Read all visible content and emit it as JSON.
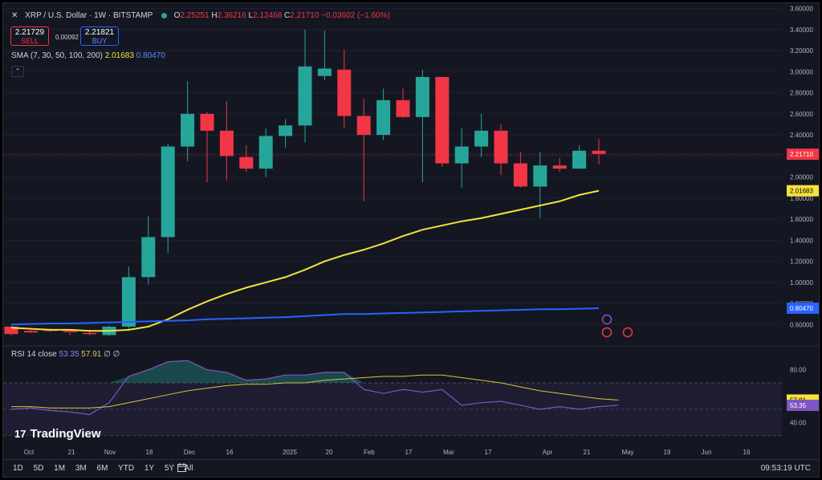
{
  "header": {
    "close_glyph": "✕",
    "symbol": "XRP / U.S. Dollar · 1W · BITSTAMP",
    "o_key": "O",
    "o_val": "2.25251",
    "h_key": "H",
    "h_val": "2.36216",
    "l_key": "L",
    "l_val": "2.12468",
    "c_key": "C",
    "c_val": "2.21710",
    "change": "−0.03602 (−1.60%)"
  },
  "trade": {
    "sell_price": "2.21729",
    "sell_label": "SELL",
    "spread": "0.00092",
    "buy_price": "2.21821",
    "buy_label": "BUY"
  },
  "sma_legend": {
    "label": "SMA (7, 30, 50, 100, 200)",
    "v1": "2.01683",
    "v2": "0.80470"
  },
  "collapse_glyph": "⌃",
  "rsi_legend": {
    "label": "RSI 14 close",
    "v1": "53.35",
    "v2": "57.91",
    "extra": "∅ ∅"
  },
  "branding": {
    "logo": "17",
    "name": "TradingView"
  },
  "ranges": [
    "1D",
    "5D",
    "1M",
    "3M",
    "6M",
    "YTD",
    "1Y",
    "5Y",
    "All"
  ],
  "clock": "09:53:19 UTC",
  "colors": {
    "up": "#26a69a",
    "down": "#f23645",
    "sma_fast": "#f5e23b",
    "sma_slow": "#2962ff",
    "rsi": "#7e57c2",
    "rsi_ma": "#d8c43e",
    "background": "#141722"
  },
  "chart_data": [
    {
      "type": "candlestick",
      "title": "XRP / U.S. Dollar · 1W · BITSTAMP",
      "y_ticks": [
        "0.60000",
        "0.80000",
        "1.00000",
        "1.20000",
        "1.40000",
        "1.60000",
        "1.80000",
        "2.00000",
        "2.20000",
        "2.40000",
        "2.60000",
        "2.80000",
        "3.00000",
        "3.20000",
        "3.40000",
        "3.60000"
      ],
      "ylim": [
        0.45,
        3.62
      ],
      "x_labels": [
        "Oct",
        "21",
        "Nov",
        "18",
        "Dec",
        "16",
        "2025",
        "20",
        "Feb",
        "17",
        "Mar",
        "17",
        "Apr",
        "21",
        "May",
        "19",
        "Jun",
        "16"
      ],
      "last_price": 2.2171,
      "candles": [
        {
          "o": 0.58,
          "h": 0.59,
          "l": 0.5,
          "c": 0.51
        },
        {
          "o": 0.54,
          "h": 0.55,
          "l": 0.52,
          "c": 0.525
        },
        {
          "o": 0.55,
          "h": 0.56,
          "l": 0.53,
          "c": 0.54
        },
        {
          "o": 0.54,
          "h": 0.55,
          "l": 0.5,
          "c": 0.53
        },
        {
          "o": 0.52,
          "h": 0.55,
          "l": 0.5,
          "c": 0.51
        },
        {
          "o": 0.5,
          "h": 0.59,
          "l": 0.49,
          "c": 0.58
        },
        {
          "o": 0.58,
          "h": 1.15,
          "l": 0.56,
          "c": 1.05
        },
        {
          "o": 1.05,
          "h": 1.63,
          "l": 0.98,
          "c": 1.43
        },
        {
          "o": 1.43,
          "h": 2.32,
          "l": 1.28,
          "c": 2.29
        },
        {
          "o": 2.29,
          "h": 2.91,
          "l": 2.15,
          "c": 2.6
        },
        {
          "o": 2.6,
          "h": 2.62,
          "l": 1.95,
          "c": 2.44
        },
        {
          "o": 2.44,
          "h": 2.72,
          "l": 1.97,
          "c": 2.2
        },
        {
          "o": 2.19,
          "h": 2.3,
          "l": 2.05,
          "c": 2.08
        },
        {
          "o": 2.08,
          "h": 2.46,
          "l": 2.0,
          "c": 2.39
        },
        {
          "o": 2.39,
          "h": 2.55,
          "l": 2.28,
          "c": 2.49
        },
        {
          "o": 2.49,
          "h": 3.4,
          "l": 2.33,
          "c": 3.05
        },
        {
          "o": 2.96,
          "h": 3.39,
          "l": 2.92,
          "c": 3.03
        },
        {
          "o": 3.02,
          "h": 3.21,
          "l": 2.47,
          "c": 2.58
        },
        {
          "o": 2.58,
          "h": 2.74,
          "l": 1.77,
          "c": 2.4
        },
        {
          "o": 2.4,
          "h": 2.84,
          "l": 2.35,
          "c": 2.73
        },
        {
          "o": 2.73,
          "h": 2.84,
          "l": 2.56,
          "c": 2.57
        },
        {
          "o": 2.57,
          "h": 3.02,
          "l": 1.95,
          "c": 2.95
        },
        {
          "o": 2.95,
          "h": 2.95,
          "l": 2.1,
          "c": 2.13
        },
        {
          "o": 2.13,
          "h": 2.47,
          "l": 1.9,
          "c": 2.29
        },
        {
          "o": 2.29,
          "h": 2.6,
          "l": 2.19,
          "c": 2.44
        },
        {
          "o": 2.44,
          "h": 2.5,
          "l": 2.02,
          "c": 2.13
        },
        {
          "o": 2.13,
          "h": 2.24,
          "l": 1.9,
          "c": 1.91
        },
        {
          "o": 1.91,
          "h": 2.24,
          "l": 1.61,
          "c": 2.11
        },
        {
          "o": 2.11,
          "h": 2.18,
          "l": 2.05,
          "c": 2.08
        },
        {
          "o": 2.08,
          "h": 2.3,
          "l": 2.08,
          "c": 2.25
        },
        {
          "o": 2.25,
          "h": 2.36,
          "l": 2.12,
          "c": 2.22
        }
      ],
      "series": [
        {
          "name": "SMA 7",
          "values": [
            0.57,
            0.56,
            0.55,
            0.55,
            0.54,
            0.54,
            0.55,
            0.58,
            0.65,
            0.74,
            0.82,
            0.89,
            0.95,
            1.0,
            1.05,
            1.12,
            1.2,
            1.26,
            1.31,
            1.37,
            1.44,
            1.5,
            1.54,
            1.58,
            1.61,
            1.65,
            1.69,
            1.73,
            1.77,
            1.83,
            1.87
          ]
        },
        {
          "name": "SMA 30",
          "values": [
            0.6,
            0.605,
            0.61,
            0.61,
            0.615,
            0.62,
            0.625,
            0.63,
            0.635,
            0.64,
            0.65,
            0.655,
            0.66,
            0.665,
            0.67,
            0.68,
            0.69,
            0.7,
            0.7,
            0.705,
            0.71,
            0.715,
            0.72,
            0.725,
            0.73,
            0.735,
            0.74,
            0.745,
            0.745,
            0.75,
            0.755
          ]
        }
      ]
    },
    {
      "type": "line",
      "title": "RSI 14 close",
      "y_ticks": [
        "40.00",
        "80.00"
      ],
      "ylim": [
        28,
        95
      ],
      "series": [
        {
          "name": "RSI",
          "values": [
            50,
            51,
            49,
            48,
            46,
            55,
            75,
            80,
            86,
            87,
            80,
            78,
            72,
            73,
            76,
            76,
            78,
            78,
            65,
            62,
            65,
            63,
            65,
            53,
            55,
            56,
            53,
            50,
            52,
            50,
            52,
            53
          ]
        },
        {
          "name": "RSI MA",
          "values": [
            52,
            52,
            51,
            51,
            51,
            52,
            55,
            58,
            61,
            64,
            66,
            68,
            69,
            69,
            70,
            70,
            72,
            73,
            74,
            75,
            75,
            76,
            76,
            74,
            72,
            70,
            67,
            64,
            62,
            60,
            58,
            57
          ]
        }
      ]
    }
  ]
}
